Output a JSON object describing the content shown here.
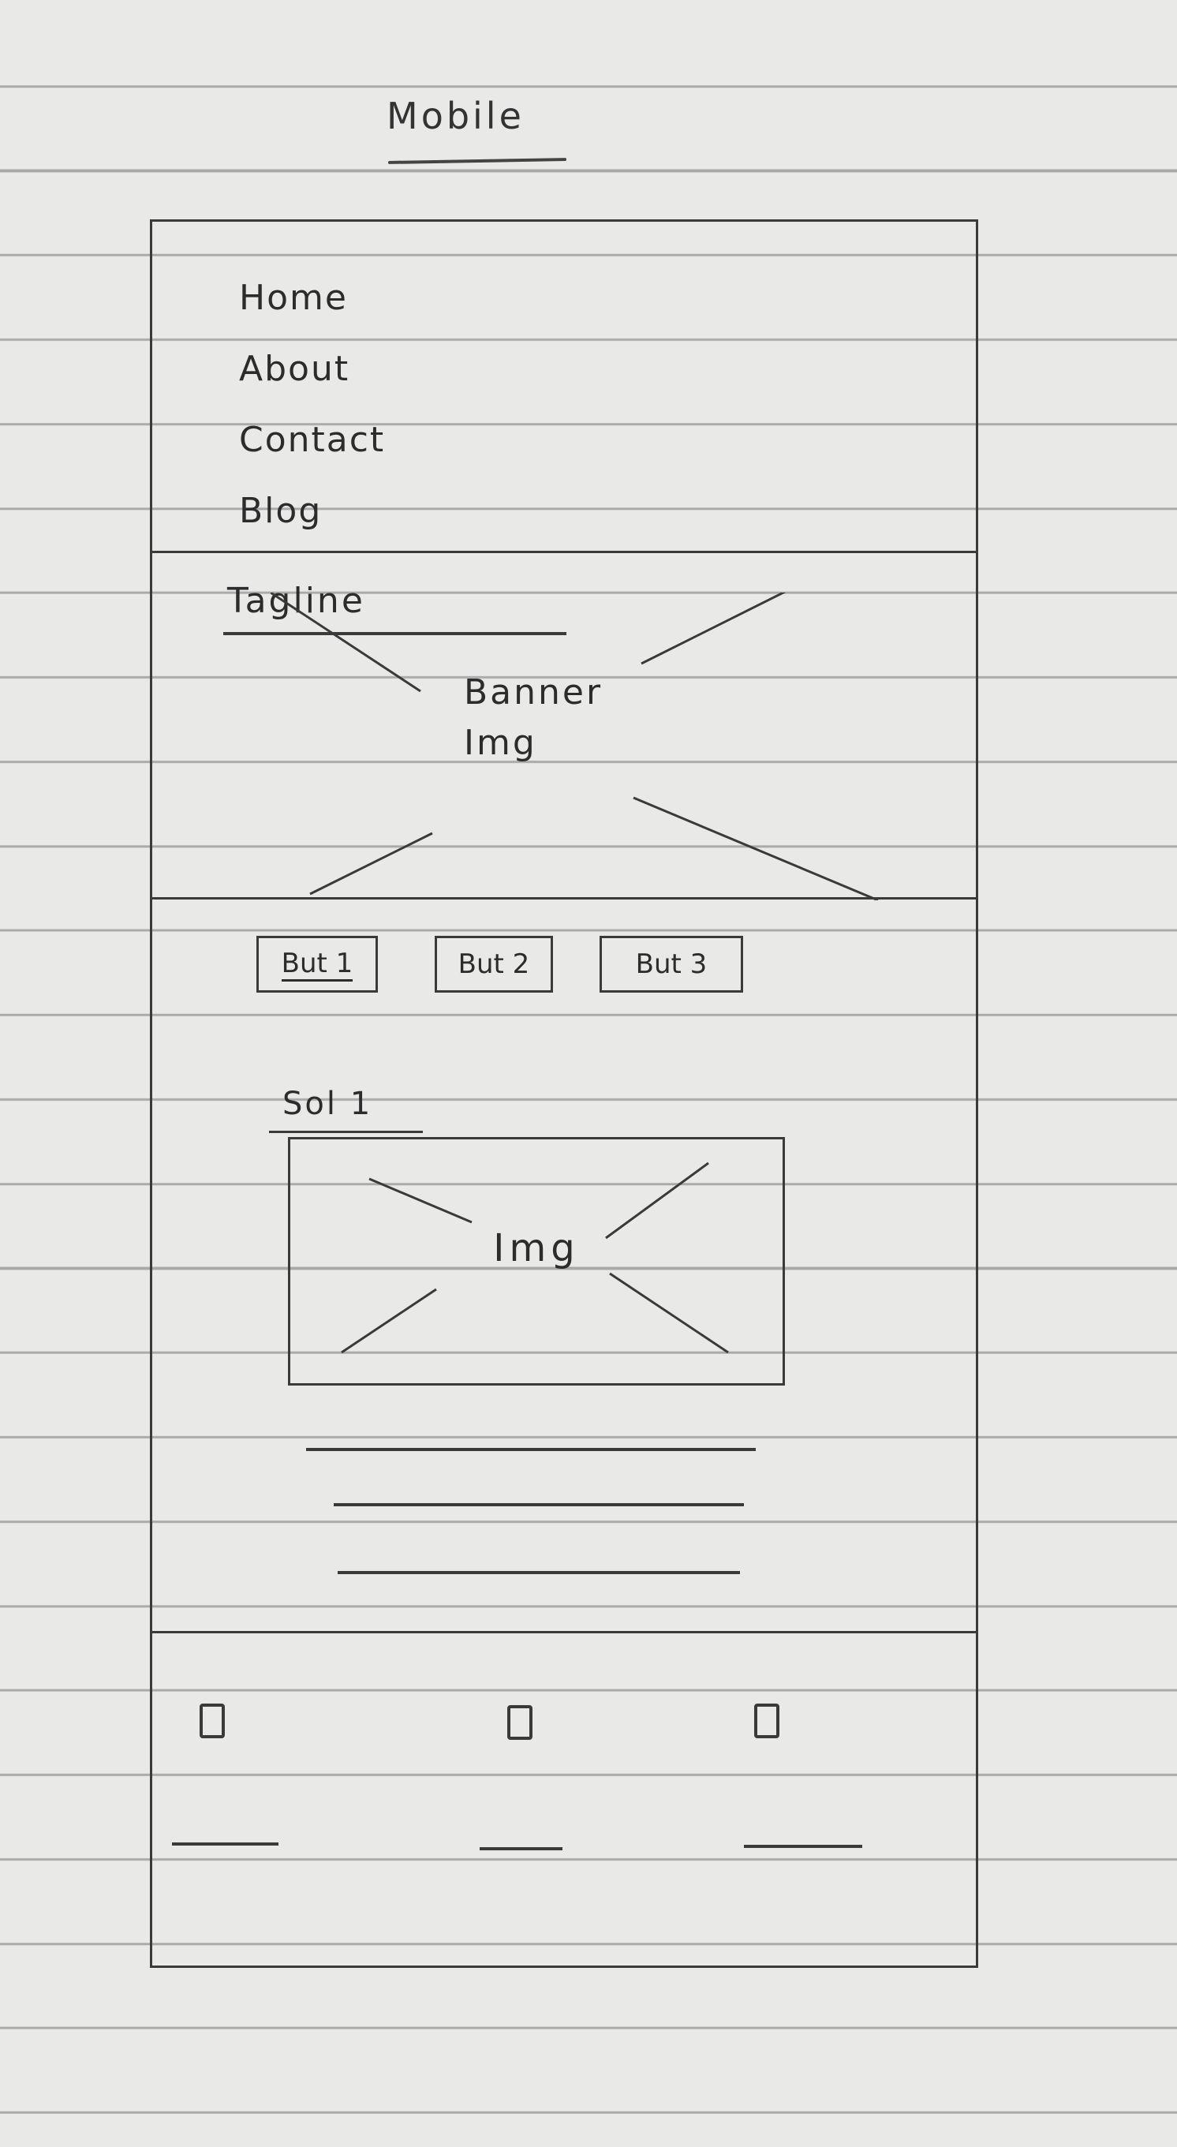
{
  "page": {
    "title": "Mobile"
  },
  "nav": {
    "items": [
      {
        "label": "Home"
      },
      {
        "label": "About"
      },
      {
        "label": "Contact"
      },
      {
        "label": "Blog"
      }
    ]
  },
  "hero": {
    "tagline": "Tagline",
    "banner_label_line1": "Banner",
    "banner_label_line2": "Img"
  },
  "tabs": [
    {
      "label": "But 1",
      "active": true
    },
    {
      "label": "But 2",
      "active": false
    },
    {
      "label": "But 3",
      "active": false
    }
  ],
  "content": {
    "heading": "Sol 1",
    "image_label": "Img"
  }
}
